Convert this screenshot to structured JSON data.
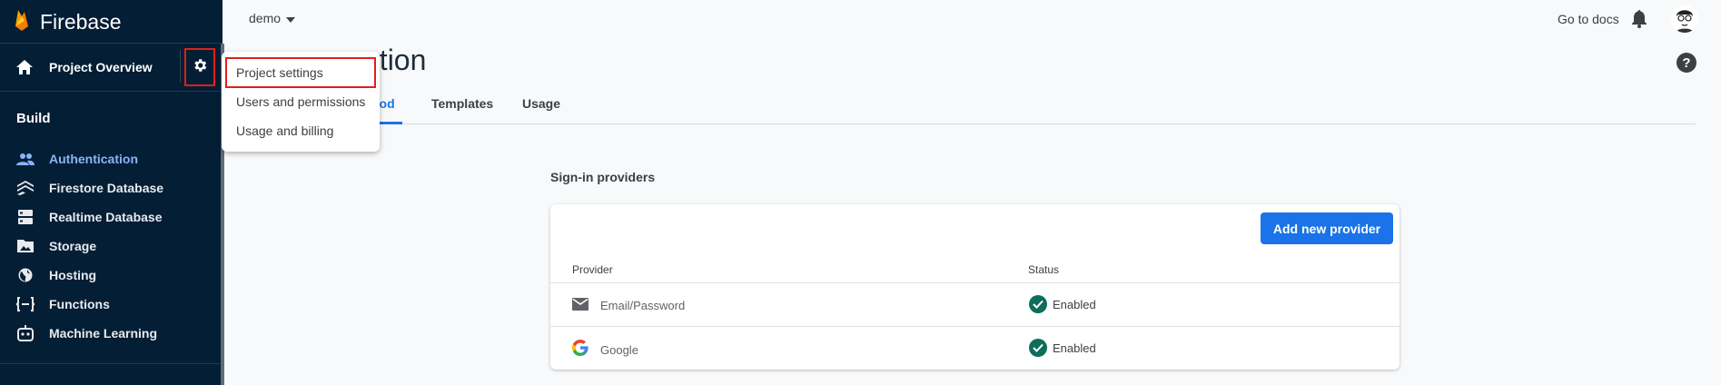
{
  "brand": {
    "name": "Firebase"
  },
  "sidebar": {
    "overview_label": "Project Overview",
    "section_title": "Build",
    "items": [
      {
        "label": "Authentication",
        "icon": "people-icon",
        "active": true
      },
      {
        "label": "Firestore Database",
        "icon": "firestore-icon"
      },
      {
        "label": "Realtime Database",
        "icon": "database-icon"
      },
      {
        "label": "Storage",
        "icon": "image-icon"
      },
      {
        "label": "Hosting",
        "icon": "globe-icon"
      },
      {
        "label": "Functions",
        "icon": "functions-icon"
      },
      {
        "label": "Machine Learning",
        "icon": "robot-icon"
      }
    ]
  },
  "topbar": {
    "project": "demo",
    "docs_link": "Go to docs"
  },
  "page": {
    "title_visible": "ation",
    "help": "?"
  },
  "tabs": [
    {
      "label": "hod",
      "active": true
    },
    {
      "label": "Templates"
    },
    {
      "label": "Usage"
    }
  ],
  "settings_menu": {
    "items": [
      "Project settings",
      "Users and permissions",
      "Usage and billing"
    ],
    "highlighted": "Project settings"
  },
  "providers": {
    "title": "Sign-in providers",
    "add_button": "Add new provider",
    "columns": [
      "Provider",
      "Status"
    ],
    "rows": [
      {
        "name": "Email/Password",
        "icon": "mail-icon",
        "status": "Enabled"
      },
      {
        "name": "Google",
        "icon": "google-icon",
        "status": "Enabled"
      }
    ]
  },
  "colors": {
    "accent": "#1a73e8",
    "sidebar_bg": "#041e35",
    "active_nav": "#8ab4f8",
    "highlight": "#e0201a",
    "enabled": "#0e6e5a"
  }
}
